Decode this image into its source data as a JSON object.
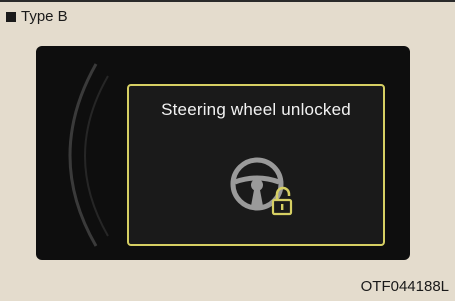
{
  "caption": {
    "label": "Type B"
  },
  "display": {
    "message": "Steering wheel unlocked",
    "icons": [
      "steering-wheel-icon",
      "unlocked-padlock-icon"
    ],
    "accent_color": "#d6cf63"
  },
  "figure_code": "OTF044188L"
}
